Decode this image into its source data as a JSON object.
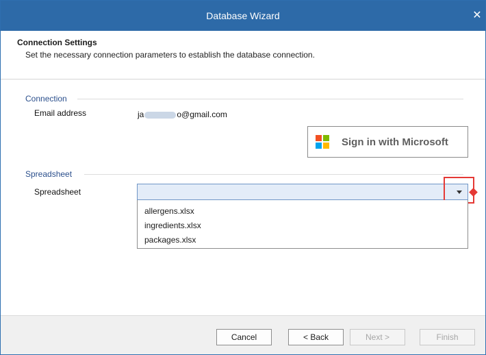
{
  "window": {
    "title": "Database Wizard",
    "close_glyph": "✕"
  },
  "header": {
    "title": "Connection Settings",
    "subtitle": "Set the necessary connection parameters to establish the database connection."
  },
  "connection": {
    "group_label": "Connection",
    "email_label": "Email address",
    "email_prefix": "ja",
    "email_suffix": "o@gmail.com",
    "sign_in_label": "Sign in with Microsoft"
  },
  "spreadsheet": {
    "group_label": "Spreadsheet",
    "field_label": "Spreadsheet",
    "selected_value": "",
    "options": [
      "allergens.xlsx",
      "ingredients.xlsx",
      "packages.xlsx"
    ]
  },
  "footer": {
    "cancel_label": "Cancel",
    "back_label": "< Back",
    "next_label": "Next >",
    "finish_label": "Finish"
  },
  "colors": {
    "titlebar": "#2d6aa8",
    "group_label": "#2b4f8c",
    "highlight": "#e53935",
    "combo_fill": "#e3ecf8"
  },
  "icons": {
    "close": "close-icon",
    "microsoft_logo": "microsoft-logo-icon",
    "dropdown_arrow": "chevron-down-icon",
    "validation_marker": "error-diamond-icon"
  }
}
